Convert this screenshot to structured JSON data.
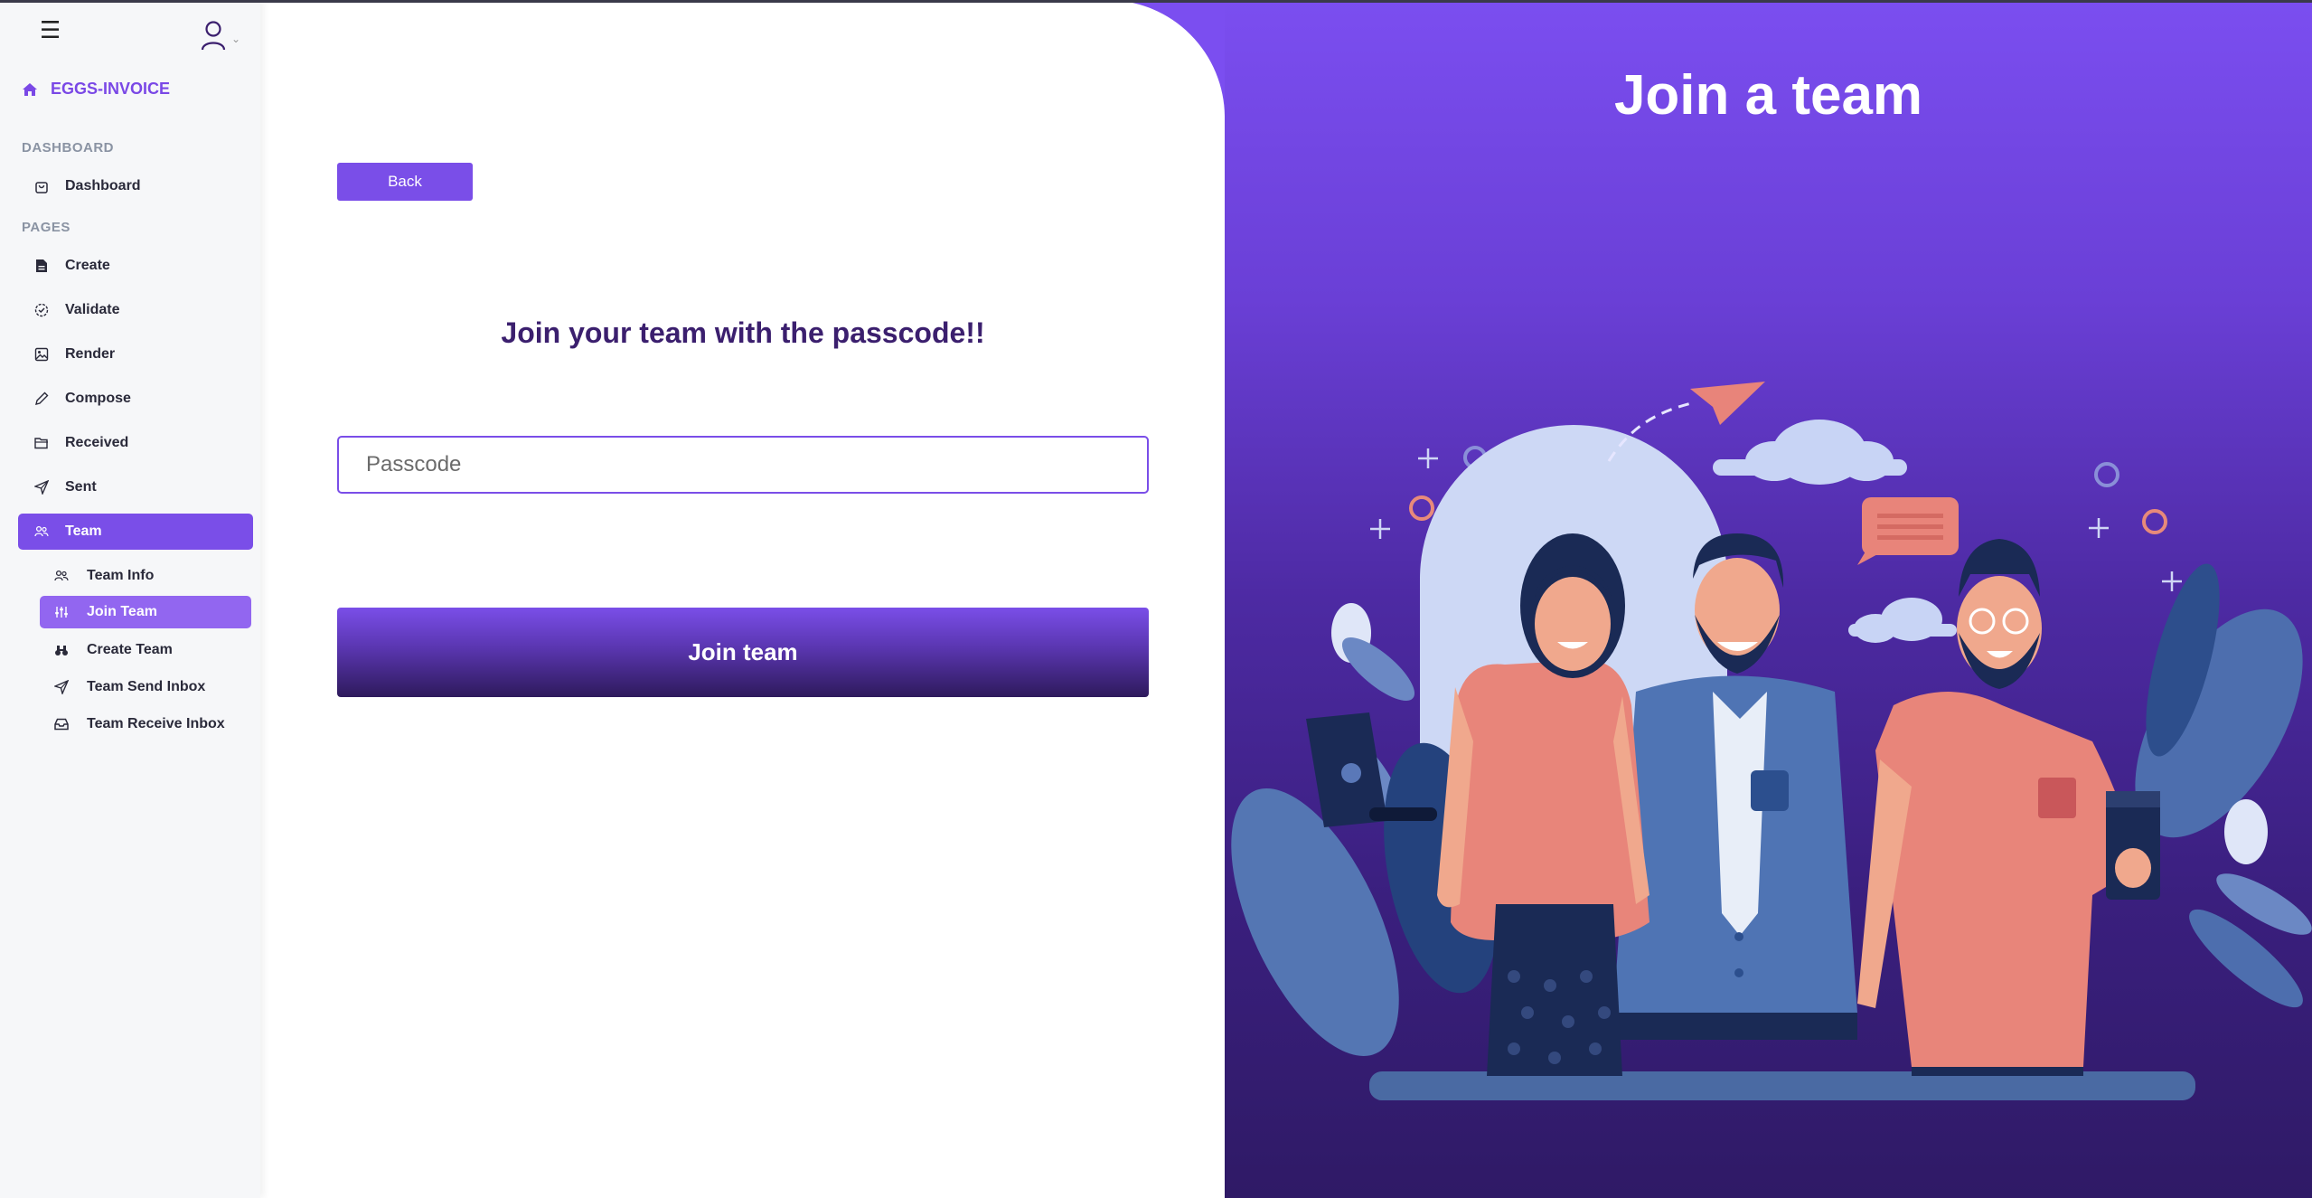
{
  "sidebar": {
    "brand": "EGGS-INVOICE",
    "sections": {
      "dashboard": "DASHBOARD",
      "pages": "PAGES"
    },
    "items": {
      "dashboard": "Dashboard",
      "create": "Create",
      "validate": "Validate",
      "render": "Render",
      "compose": "Compose",
      "received": "Received",
      "sent": "Sent",
      "team": "Team"
    },
    "team_sub": {
      "info": "Team Info",
      "join": "Join Team",
      "create": "Create Team",
      "send_inbox": "Team Send Inbox",
      "receive_inbox": "Team Receive Inbox"
    },
    "active_item": "Team",
    "active_sub_item": "Join Team"
  },
  "form": {
    "back_label": "Back",
    "heading": "Join your team with the passcode!!",
    "passcode_placeholder": "Passcode",
    "passcode_value": "",
    "submit_label": "Join team"
  },
  "hero": {
    "title": "Join a team"
  },
  "colors": {
    "accent": "#7a4ee8",
    "heading": "#3b1f6e",
    "hero_top": "#7b4ef0",
    "hero_bottom": "#2f1a66"
  }
}
